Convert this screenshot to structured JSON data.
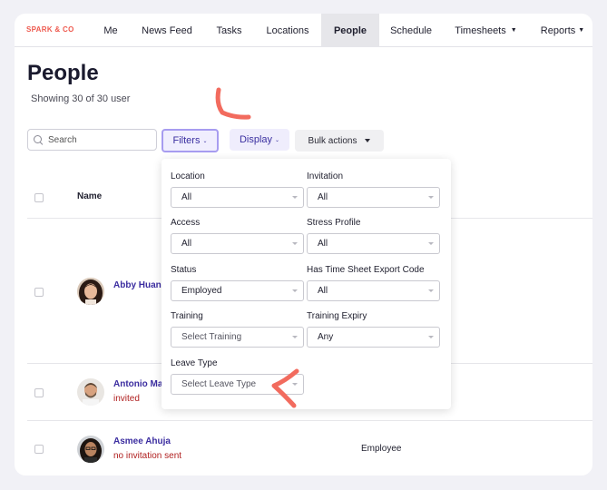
{
  "brand": "SPARK & CO",
  "nav": {
    "items": [
      {
        "label": "Me"
      },
      {
        "label": "News Feed"
      },
      {
        "label": "Tasks"
      },
      {
        "label": "Locations"
      },
      {
        "label": "People",
        "active": true
      },
      {
        "label": "Schedule"
      },
      {
        "label": "Timesheets"
      },
      {
        "label": "Reports"
      }
    ],
    "caret": "▼"
  },
  "page": {
    "title": "People",
    "subtitle": "Showing 30 of 30 user"
  },
  "toolbar": {
    "search_placeholder": "Search",
    "filters_label": "Filters",
    "display_label": "Display",
    "bulk_label": "Bulk actions",
    "small_caret": "⌄"
  },
  "table": {
    "header_name": "Name",
    "rows": [
      {
        "name": "Abby Huang",
        "status": "",
        "role": ""
      },
      {
        "name": "Antonio Ma",
        "status": "invited",
        "role": ""
      },
      {
        "name": "Asmee Ahuja",
        "status": "no invitation sent",
        "role": "Employee"
      }
    ]
  },
  "filters": {
    "location": {
      "label": "Location",
      "value": "All"
    },
    "invitation": {
      "label": "Invitation",
      "value": "All"
    },
    "access": {
      "label": "Access",
      "value": "All"
    },
    "stress_profile": {
      "label": "Stress Profile",
      "value": "All"
    },
    "status": {
      "label": "Status",
      "value": "Employed"
    },
    "export_code": {
      "label": "Has Time Sheet Export Code",
      "value": "All"
    },
    "training": {
      "label": "Training",
      "value": "Select Training"
    },
    "training_expiry": {
      "label": "Training Expiry",
      "value": "Any"
    },
    "leave_type": {
      "label": "Leave Type",
      "value": "Select Leave Type"
    }
  },
  "colors": {
    "accent": "#3a2fa0",
    "brand": "#ee5a4f",
    "annotation": "#f26b5e",
    "status_red": "#b02020"
  }
}
